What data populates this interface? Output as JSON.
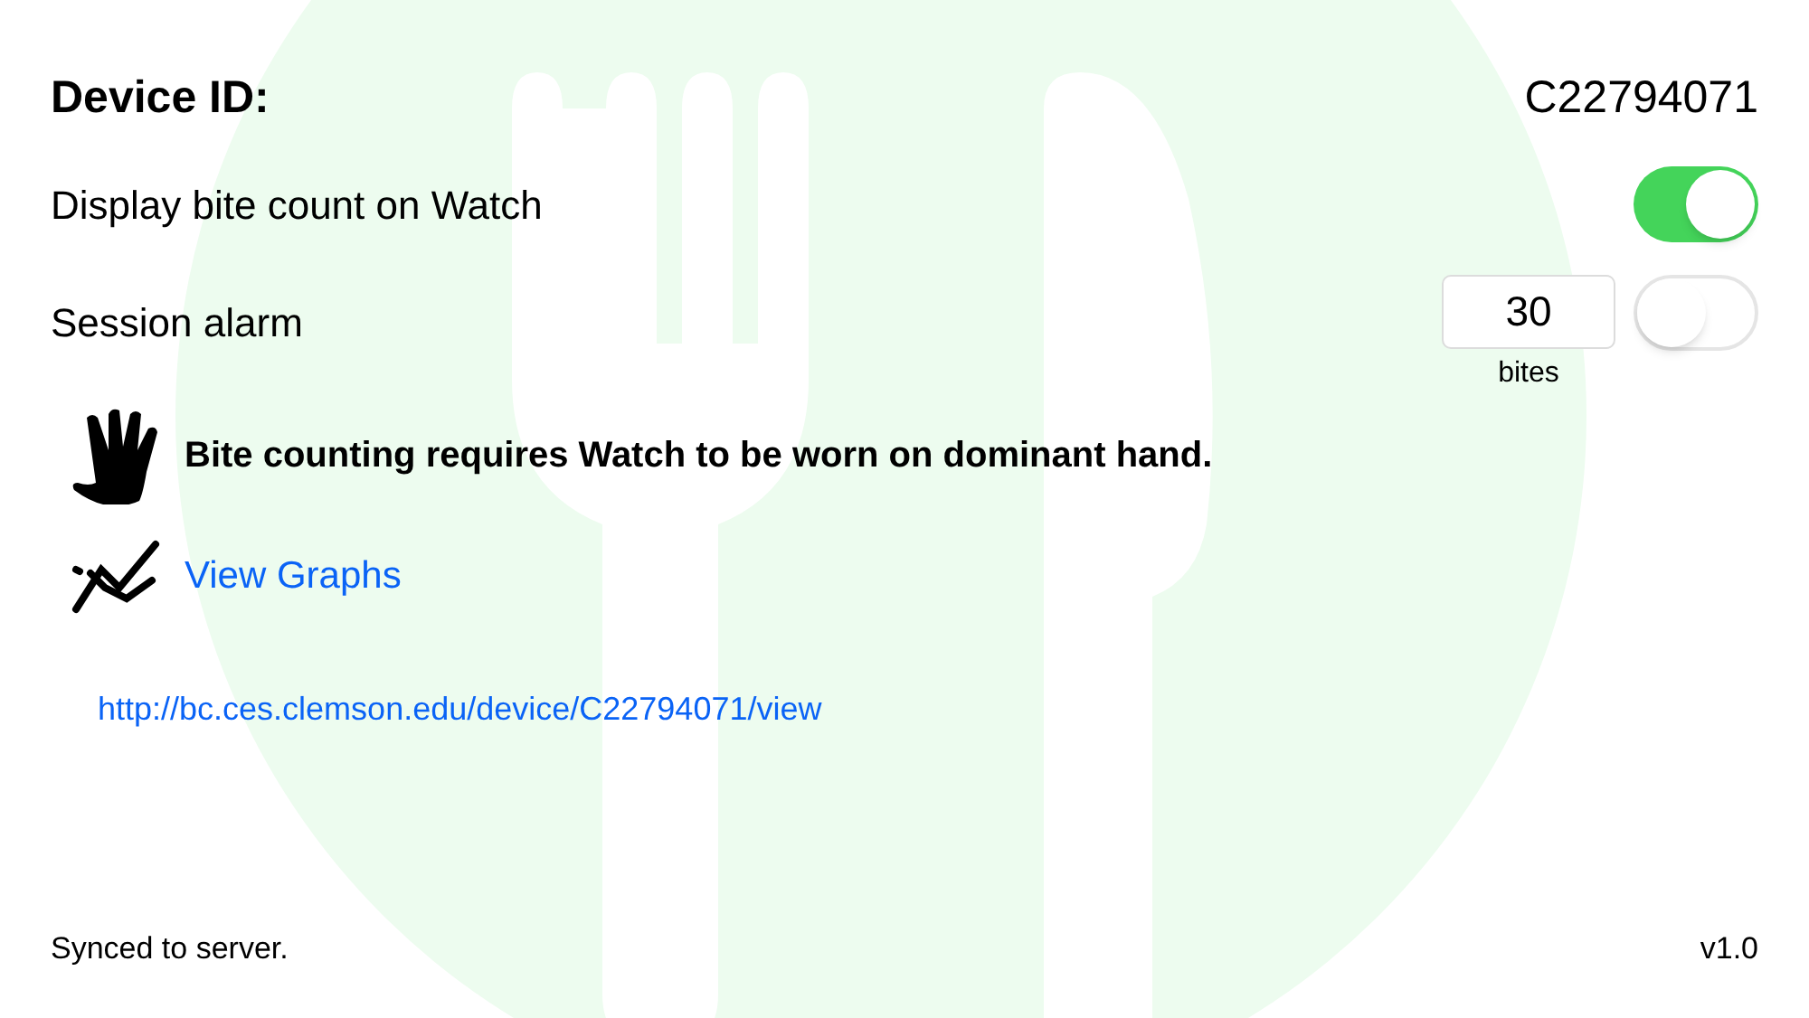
{
  "device_id": {
    "label": "Device ID:",
    "value": "C22794071"
  },
  "settings": [
    {
      "kind": "toggle",
      "label": "Display bite count on Watch",
      "on": true
    },
    {
      "kind": "alarm",
      "label": "Session alarm",
      "value": "30",
      "unit": "bites",
      "on": false
    }
  ],
  "notice": "Bite counting requires Watch to be worn on dominant hand.",
  "graphs_link": "View Graphs",
  "url": "http://bc.ces.clemson.edu/device/C22794071/view",
  "footer": {
    "status": "Synced to server.",
    "version": "v1.0"
  }
}
